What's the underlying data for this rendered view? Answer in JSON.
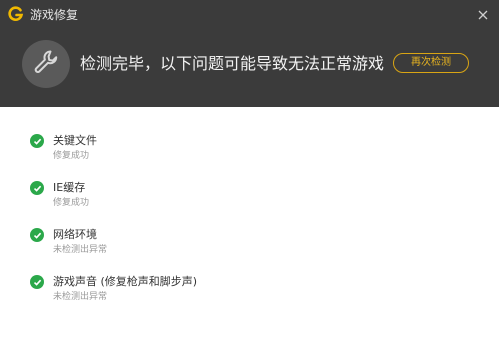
{
  "window": {
    "title": "游戏修复"
  },
  "header": {
    "message": "检测完毕，以下问题可能导致无法正常游戏",
    "recheck_label": "再次检测",
    "icon": "wrench-icon"
  },
  "items": [
    {
      "title": "关键文件",
      "status": "修复成功",
      "icon": "check-circle-icon"
    },
    {
      "title": "IE缓存",
      "status": "修复成功",
      "icon": "check-circle-icon"
    },
    {
      "title": "网络环境",
      "status": "未检测出异常",
      "icon": "check-circle-icon"
    },
    {
      "title": "游戏声音 (修复枪声和脚步声)",
      "status": "未检测出异常",
      "icon": "check-circle-icon"
    }
  ],
  "colors": {
    "header_bg": "#3b3b3b",
    "accent": "#e8b420",
    "success": "#2ba84a"
  }
}
